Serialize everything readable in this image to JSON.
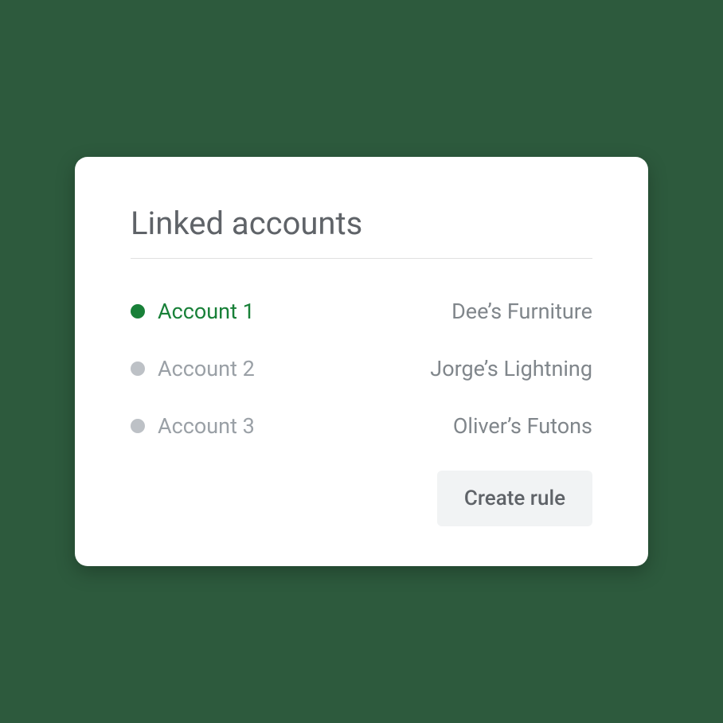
{
  "card": {
    "title": "Linked accounts",
    "accounts": [
      {
        "label": "Account 1",
        "name": "Dee’s Furniture",
        "active": true
      },
      {
        "label": "Account 2",
        "name": "Jorge’s Lightning",
        "active": false
      },
      {
        "label": "Account 3",
        "name": "Oliver’s Futons",
        "active": false
      }
    ],
    "button_label": "Create rule"
  },
  "colors": {
    "background": "#2d5a3d",
    "active": "#188038",
    "inactive_dot": "#bdc1c6",
    "text_muted": "#5f6368"
  }
}
